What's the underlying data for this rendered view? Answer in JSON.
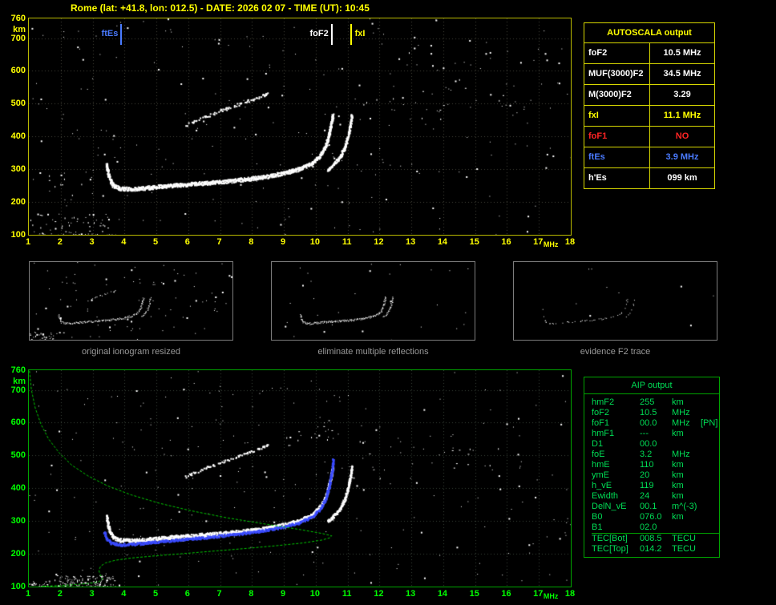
{
  "title": "Rome (lat: +41.8, lon: 012.5) - DATE: 2026 02 07 - TIME (UT): 10:45",
  "colors": {
    "accent_yellow": "#ffff00",
    "accent_green": "#00dd55",
    "accent_blue": "#4a7bff",
    "accent_red": "#ff2424",
    "trace_white": "#ffffff",
    "fitted_trace_blue": "#3a4bff",
    "profile_green": "#00cc00"
  },
  "autoscala": {
    "title": "AUTOSCALA output",
    "rows": [
      {
        "label": "foF2",
        "value": "10.5 MHz",
        "color": "white"
      },
      {
        "label": "MUF(3000)F2",
        "value": "34.5 MHz",
        "color": "white"
      },
      {
        "label": "M(3000)F2",
        "value": "3.29",
        "color": "white"
      },
      {
        "label": "fxI",
        "value": "11.1 MHz",
        "color": "yellow"
      },
      {
        "label": "foF1",
        "value": "NO",
        "color": "red"
      },
      {
        "label": "ftEs",
        "value": "3.9 MHz",
        "color": "blue"
      },
      {
        "label": "h'Es",
        "value": "099   km",
        "color": "white"
      }
    ]
  },
  "aip": {
    "title": "AIP output",
    "rows": [
      {
        "name": "hmF2",
        "value": "255",
        "unit": "km"
      },
      {
        "name": "foF2",
        "value": "10.5",
        "unit": "MHz"
      },
      {
        "name": "foF1",
        "value": "00.0",
        "unit": "MHz",
        "extra": "[PN]"
      },
      {
        "name": "hmF1",
        "value": "---",
        "unit": "km"
      },
      {
        "name": "D1",
        "value": "00.0",
        "unit": ""
      },
      {
        "name": "foE",
        "value": "3.2",
        "unit": "MHz"
      },
      {
        "name": "hmE",
        "value": "110",
        "unit": "km"
      },
      {
        "name": "ymE",
        "value": "20",
        "unit": "km"
      },
      {
        "name": "h_vE",
        "value": "119",
        "unit": "km"
      },
      {
        "name": "Ewidth",
        "value": "24",
        "unit": "km"
      },
      {
        "name": "DelN_vE",
        "value": "00.1",
        "unit": "m^(-3)"
      },
      {
        "name": "B0",
        "value": "076.0",
        "unit": "km"
      },
      {
        "name": "B1",
        "value": "02.0",
        "unit": ""
      },
      {
        "name": "TEC[Bot]",
        "value": "008.5",
        "unit": "TECU"
      },
      {
        "name": "TEC[Top]",
        "value": "014.2",
        "unit": "TECU"
      }
    ]
  },
  "thumbnails": {
    "captions": [
      "original ionogram resized",
      "eliminate multiple reflections",
      "evidence F2 trace"
    ]
  },
  "chart_data": [
    {
      "id": "main-ionogram",
      "dom": "plot-main",
      "type": "scatter",
      "title": "scaled ionogram",
      "xlabel": "MHz",
      "ylabel": "km",
      "xlim": [
        1,
        18
      ],
      "ylim": [
        100,
        760
      ],
      "xticks": [
        1,
        2,
        3,
        4,
        5,
        6,
        7,
        8,
        9,
        10,
        11,
        12,
        13,
        14,
        15,
        16,
        17,
        18
      ],
      "yticks": [
        100,
        200,
        300,
        400,
        500,
        600,
        700,
        760
      ],
      "label_color": "#ffff00",
      "grid": {
        "color": "#45453a"
      },
      "seed": 11,
      "markers": [
        {
          "label": "ftEs",
          "freq": 3.9,
          "color": "#4a7bff",
          "side": "left"
        },
        {
          "label": "foF2",
          "freq": 10.5,
          "color": "#ffffff",
          "side": "left"
        },
        {
          "label": "fxI",
          "freq": 11.1,
          "color": "#ffff00",
          "side": "right"
        }
      ],
      "noise": {
        "count": 240,
        "color": "#ffffff",
        "clusters": [
          {
            "x": [
              1,
              3.5
            ],
            "y": [
              100,
              165
            ],
            "count": 55
          },
          {
            "x": [
              11,
              17
            ],
            "y": [
              440,
              560
            ],
            "count": 30
          },
          {
            "x": [
              1.3,
              3
            ],
            "y": [
              220,
              300
            ],
            "count": 16
          },
          {
            "x": [
              12,
              15.5
            ],
            "y": [
              570,
              660
            ],
            "count": 12
          }
        ]
      },
      "series": [
        {
          "name": "f2-ordinary",
          "color": "#ffffff",
          "thickness": 3,
          "density": 3,
          "points": [
            [
              3.42,
              315
            ],
            [
              3.5,
              278
            ],
            [
              3.62,
              252
            ],
            [
              3.85,
              243
            ],
            [
              4.3,
              241
            ],
            [
              4.8,
              246
            ],
            [
              5.5,
              252
            ],
            [
              6.2,
              257
            ],
            [
              7.0,
              263
            ],
            [
              7.8,
              271
            ],
            [
              8.5,
              280
            ],
            [
              9.0,
              290
            ],
            [
              9.5,
              303
            ],
            [
              9.9,
              321
            ],
            [
              10.15,
              346
            ],
            [
              10.32,
              379
            ],
            [
              10.42,
              416
            ],
            [
              10.5,
              456
            ],
            [
              10.53,
              468
            ]
          ]
        },
        {
          "name": "f2-extraordinary",
          "color": "#ffffff",
          "thickness": 2.5,
          "density": 2.5,
          "points": [
            [
              10.35,
              299
            ],
            [
              10.55,
              316
            ],
            [
              10.75,
              339
            ],
            [
              10.9,
              369
            ],
            [
              11.0,
              403
            ],
            [
              11.08,
              439
            ],
            [
              11.12,
              468
            ]
          ]
        },
        {
          "name": "second-reflection",
          "color": "#ffffff",
          "thickness": 2,
          "density": 1.1,
          "gap": 0.45,
          "points": [
            [
              5.9,
              436
            ],
            [
              6.4,
              458
            ],
            [
              7.0,
              480
            ],
            [
              7.6,
              501
            ],
            [
              8.1,
              518
            ],
            [
              8.5,
              533
            ]
          ]
        },
        {
          "name": "sporadic-e",
          "color": "#ffffff",
          "thickness": 1.5,
          "density": 0.5,
          "gap": 0.55,
          "points": [
            [
              1.3,
              103
            ],
            [
              1.8,
              101
            ],
            [
              2.3,
              100
            ],
            [
              2.9,
              102
            ],
            [
              3.4,
              101
            ],
            [
              3.8,
              100
            ]
          ]
        }
      ]
    },
    {
      "id": "aip-ionogram",
      "dom": "plot-bottom",
      "type": "scatter",
      "title": "ionogram with restored trace and electron density profile",
      "xlabel": "MHz",
      "ylabel": "km",
      "xlim": [
        1,
        18
      ],
      "ylim": [
        100,
        760
      ],
      "xticks": [
        1,
        2,
        3,
        4,
        5,
        6,
        7,
        8,
        9,
        10,
        11,
        12,
        13,
        14,
        15,
        16,
        17,
        18
      ],
      "yticks": [
        100,
        200,
        300,
        400,
        500,
        600,
        700,
        760
      ],
      "label_color": "#00ff00",
      "grid": {
        "color": "#3a453a"
      },
      "seed": 29,
      "noise": {
        "count": 250,
        "color": "#ffffff",
        "clusters": [
          {
            "x": [
              1.8,
              3.7
            ],
            "y": [
              100,
              135
            ],
            "count": 110
          },
          {
            "x": [
              1,
              1.7
            ],
            "y": [
              100,
              118
            ],
            "count": 18
          },
          {
            "x": [
              8.8,
              10.6
            ],
            "y": [
              530,
              620
            ],
            "count": 20
          },
          {
            "x": [
              11,
              16.5
            ],
            "y": [
              430,
              545
            ],
            "count": 28
          }
        ]
      },
      "series": [
        {
          "use": "f2-ordinary"
        },
        {
          "use": "f2-extraordinary"
        },
        {
          "use": "second-reflection"
        },
        {
          "use": "sporadic-e"
        },
        {
          "name": "restored-trace",
          "color": "#3a4bff",
          "thickness": 2,
          "density": 2.2,
          "points": [
            [
              3.35,
              268
            ],
            [
              3.45,
              244
            ],
            [
              3.6,
              233
            ],
            [
              3.9,
              229
            ],
            [
              4.4,
              232
            ],
            [
              5.0,
              238
            ],
            [
              5.8,
              245
            ],
            [
              6.6,
              252
            ],
            [
              7.4,
              260
            ],
            [
              8.2,
              270
            ],
            [
              8.9,
              282
            ],
            [
              9.5,
              297
            ],
            [
              9.9,
              316
            ],
            [
              10.15,
              341
            ],
            [
              10.3,
              371
            ],
            [
              10.42,
              411
            ],
            [
              10.5,
              456
            ],
            [
              10.54,
              492
            ]
          ]
        },
        {
          "name": "electron-density-profile",
          "color": "#00cc00",
          "line": true,
          "dash": [
            3,
            2
          ],
          "points": [
            [
              1.02,
              758
            ],
            [
              1.08,
              700
            ],
            [
              1.2,
              645
            ],
            [
              1.38,
              595
            ],
            [
              1.62,
              550
            ],
            [
              1.95,
              508
            ],
            [
              2.35,
              470
            ],
            [
              2.85,
              438
            ],
            [
              3.45,
              408
            ],
            [
              4.2,
              380
            ],
            [
              5.1,
              354
            ],
            [
              6.1,
              331
            ],
            [
              7.2,
              310
            ],
            [
              8.4,
              291
            ],
            [
              9.5,
              274
            ],
            [
              10.2,
              262
            ],
            [
              10.45,
              256
            ],
            [
              10.5,
              255
            ],
            [
              10.45,
              249
            ],
            [
              10.2,
              242
            ],
            [
              9.6,
              233
            ],
            [
              8.8,
              225
            ],
            [
              7.9,
              217
            ],
            [
              6.9,
              209
            ],
            [
              5.9,
              201
            ],
            [
              5.0,
              194
            ],
            [
              4.2,
              187
            ],
            [
              3.7,
              180
            ],
            [
              3.4,
              172
            ],
            [
              3.25,
              162
            ],
            [
              3.2,
              150
            ],
            [
              3.22,
              140
            ],
            [
              3.28,
              130
            ],
            [
              3.3,
              122
            ],
            [
              3.2,
              115
            ],
            [
              3.0,
              111
            ],
            [
              2.6,
              107
            ],
            [
              2.0,
              103
            ],
            [
              1.4,
              101
            ]
          ]
        }
      ]
    },
    {
      "id": "thumb-original",
      "dom": "thumb-0",
      "type": "scatter",
      "title": "original ionogram resized",
      "xlim": [
        1,
        18
      ],
      "ylim": [
        100,
        760
      ],
      "seed": 41,
      "noise": {
        "count": 90,
        "color": "#ffffff",
        "clusters": [
          {
            "x": [
              1,
              4
            ],
            "y": [
              100,
              180
            ],
            "count": 25
          }
        ]
      },
      "series": [
        {
          "use": "f2-ordinary",
          "thickness": 1.5,
          "density": 1.3
        },
        {
          "use": "f2-extraordinary",
          "thickness": 1,
          "density": 1
        },
        {
          "use": "second-reflection",
          "thickness": 1,
          "density": 0.7,
          "gap": 0.5
        },
        {
          "use": "sporadic-e",
          "thickness": 1,
          "density": 0.4,
          "gap": 0.6
        }
      ]
    },
    {
      "id": "thumb-cleaned",
      "dom": "thumb-1",
      "type": "scatter",
      "title": "eliminate multiple reflections",
      "xlim": [
        1,
        18
      ],
      "ylim": [
        100,
        760
      ],
      "seed": 53,
      "noise": {
        "count": 30,
        "color": "#ffffff",
        "clusters": []
      },
      "series": [
        {
          "use": "f2-ordinary",
          "thickness": 1.5,
          "density": 1.5
        },
        {
          "use": "f2-extraordinary",
          "thickness": 1,
          "density": 1.2
        }
      ]
    },
    {
      "id": "thumb-f2-trace",
      "dom": "thumb-2",
      "type": "scatter",
      "title": "evidence F2 trace",
      "xlim": [
        1,
        18
      ],
      "ylim": [
        100,
        760
      ],
      "seed": 67,
      "noise": {
        "count": 10,
        "color": "#ffffff",
        "clusters": []
      },
      "series": [
        {
          "use": "f2-ordinary",
          "thickness": 1,
          "density": 0.6,
          "gap": 0.35
        },
        {
          "use": "f2-extraordinary",
          "thickness": 1,
          "density": 0.5,
          "gap": 0.4
        }
      ]
    }
  ]
}
